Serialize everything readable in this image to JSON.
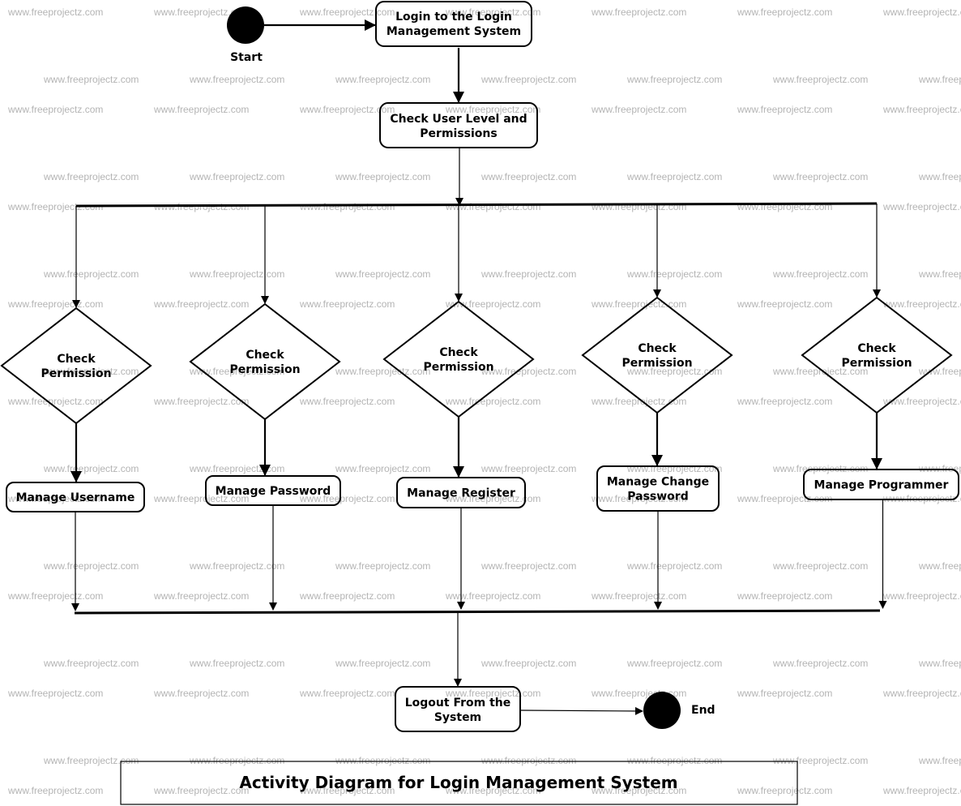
{
  "watermark": "www.freeprojectz.com",
  "title": "Activity Diagram for Login Management System",
  "start": {
    "label": "Start"
  },
  "end": {
    "label": "End"
  },
  "activities": {
    "login": [
      "Login to the Login",
      "Management System"
    ],
    "check_level": [
      "Check User Level and",
      "Permissions"
    ],
    "logout": [
      "Logout From the",
      "System"
    ]
  },
  "branches": [
    {
      "decision": [
        "Check",
        "Permission"
      ],
      "action": [
        "Manage Username"
      ]
    },
    {
      "decision": [
        "Check",
        "Permission"
      ],
      "action": [
        "Manage Password"
      ]
    },
    {
      "decision": [
        "Check",
        "Permission"
      ],
      "action": [
        "Manage Register"
      ]
    },
    {
      "decision": [
        "Check",
        "Permission"
      ],
      "action": [
        "Manage Change",
        "Password"
      ]
    },
    {
      "decision": [
        "Check",
        "Permission"
      ],
      "action": [
        "Manage Programmer"
      ]
    }
  ],
  "colors": {
    "stroke": "#000000",
    "watermark": "#b4b4b4",
    "background": "#ffffff"
  }
}
